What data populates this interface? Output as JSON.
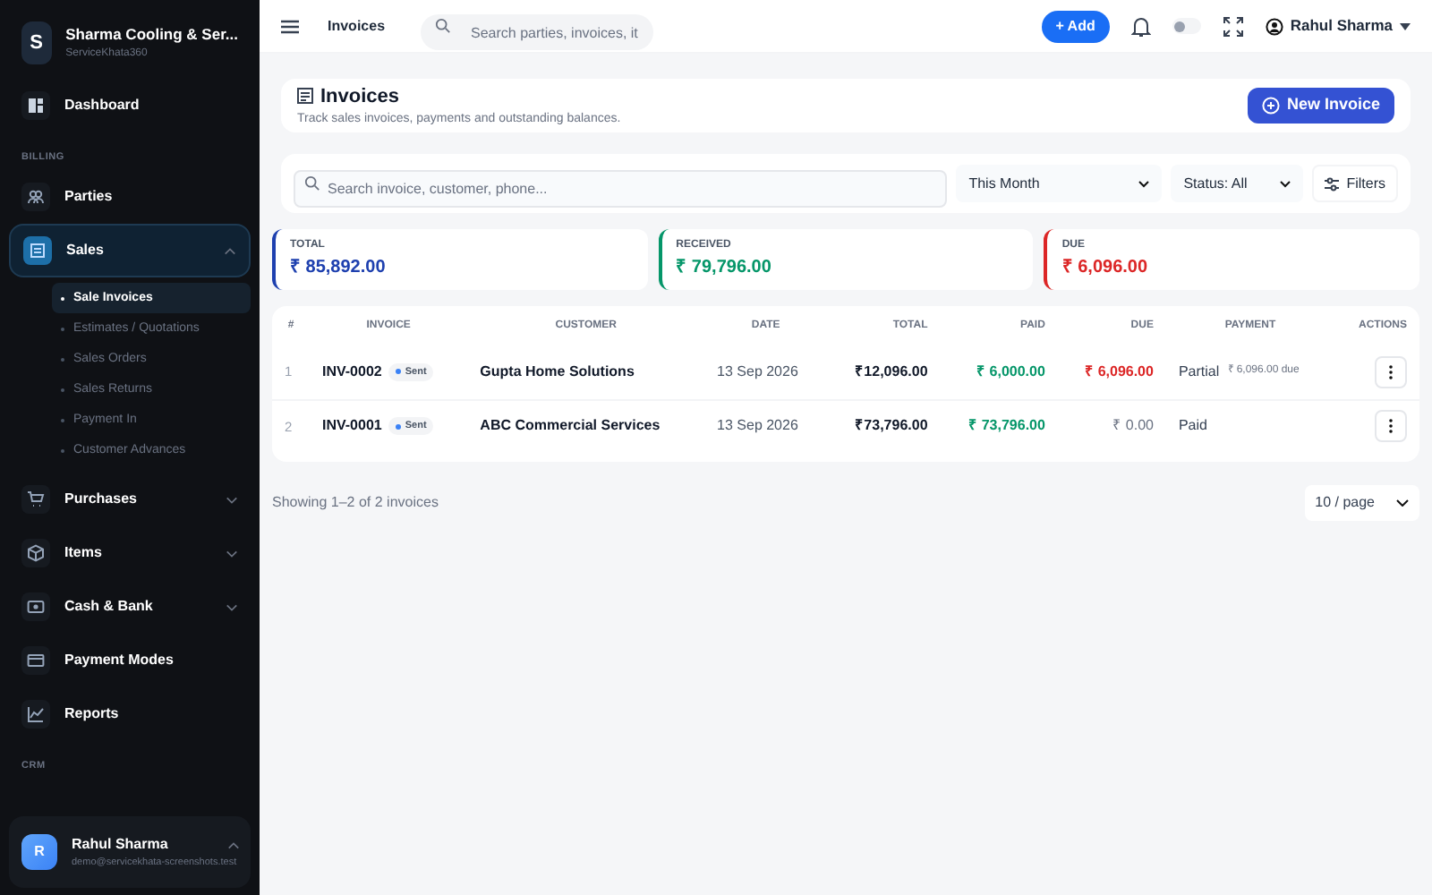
{
  "brand": {
    "initial": "S",
    "name": "Sharma Cooling & Ser...",
    "subtitle": "ServiceKhata360"
  },
  "sidebar": {
    "items": [
      {
        "kind": "item",
        "label": "Dashboard"
      },
      {
        "kind": "section",
        "label": "BILLING"
      },
      {
        "kind": "item",
        "label": "Parties"
      },
      {
        "kind": "group",
        "label": "Sales",
        "expanded": true,
        "selected": true,
        "children": [
          {
            "label": "Sale Invoices",
            "selected": true
          },
          {
            "label": "Estimates / Quotations",
            "selected": false
          },
          {
            "label": "Sales Orders",
            "selected": false
          },
          {
            "label": "Sales Returns",
            "selected": false
          },
          {
            "label": "Payment In",
            "selected": false
          },
          {
            "label": "Customer Advances",
            "selected": false
          }
        ]
      },
      {
        "kind": "group",
        "label": "Purchases",
        "expanded": false,
        "selected": false
      },
      {
        "kind": "group",
        "label": "Items",
        "expanded": false,
        "selected": false
      },
      {
        "kind": "group",
        "label": "Cash & Bank",
        "expanded": false,
        "selected": false
      },
      {
        "kind": "item",
        "label": "Payment Modes"
      },
      {
        "kind": "item",
        "label": "Reports"
      },
      {
        "kind": "section",
        "label": "CRM"
      }
    ]
  },
  "user": {
    "initial": "R",
    "name": "Rahul Sharma",
    "email": "demo@servicekhata-screenshots.test"
  },
  "header": {
    "title": "Invoices",
    "search_placeholder": "Search parties, invoices, it",
    "add_label": "+ Add",
    "theme_toggle_on": false,
    "user_name": "Rahul Sharma"
  },
  "page": {
    "title": "Invoices",
    "subtitle": "Track sales invoices, payments and outstanding balances.",
    "new_button": "New Invoice"
  },
  "filters": {
    "search_placeholder": "Search invoice, customer, phone...",
    "period": "This Month",
    "status": "Status: All",
    "filters_button": "Filters"
  },
  "stats": [
    {
      "label": "TOTAL",
      "value": "₹ 85,892.00",
      "color": "#1e40af"
    },
    {
      "label": "RECEIVED",
      "value": "₹ 79,796.00",
      "color": "#059669"
    },
    {
      "label": "DUE",
      "value": "₹ 6,096.00",
      "color": "#dc2626"
    }
  ],
  "table": {
    "columns": [
      "#",
      "INVOICE",
      "CUSTOMER",
      "DATE",
      "TOTAL",
      "PAID",
      "DUE",
      "PAYMENT",
      "ACTIONS"
    ],
    "rows": [
      {
        "index": "1",
        "invoice": "INV-0002",
        "badge": "Sent",
        "customer": "Gupta Home Solutions",
        "date": "13 Sep 2026",
        "total": "₹12,096.00",
        "paid": "₹ 6,000.00",
        "due": "₹ 6,096.00",
        "due_outstanding": true,
        "payment": "Partial",
        "payment_note": "₹ 6,096.00 due"
      },
      {
        "index": "2",
        "invoice": "INV-0001",
        "badge": "Sent",
        "customer": "ABC Commercial Services",
        "date": "13 Sep 2026",
        "total": "₹73,796.00",
        "paid": "₹ 73,796.00",
        "due": "₹ 0.00",
        "due_outstanding": false,
        "payment": "Paid"
      }
    ]
  },
  "footer": {
    "showing": "Showing 1–2 of 2 invoices",
    "page_size": "10 / page"
  }
}
